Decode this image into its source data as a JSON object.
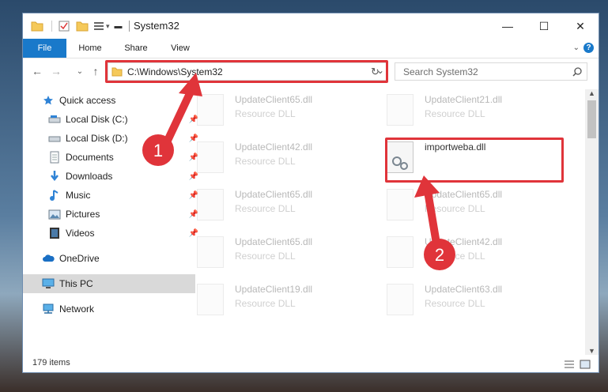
{
  "window": {
    "title": "System32",
    "minimize_glyph": "—",
    "maximize_glyph": "☐",
    "close_glyph": "✕"
  },
  "ribbon": {
    "tabs": [
      "File",
      "Home",
      "Share",
      "View"
    ],
    "help_glyph": "?"
  },
  "navigation": {
    "back_glyph": "←",
    "forward_glyph": "→",
    "recent_glyph": "⌄",
    "up_glyph": "↑",
    "address": "C:\\Windows\\System32",
    "dropdown_glyph": "⌄",
    "refresh_glyph": "↻",
    "search_placeholder": "Search System32"
  },
  "sidebar": {
    "items": [
      {
        "label": "Quick access",
        "icon": "star-icon"
      },
      {
        "label": "Local Disk (C:)",
        "icon": "drive-icon"
      },
      {
        "label": "Local Disk (D:)",
        "icon": "drive-icon"
      },
      {
        "label": "Documents",
        "icon": "documents-icon"
      },
      {
        "label": "Downloads",
        "icon": "downloads-icon"
      },
      {
        "label": "Music",
        "icon": "music-icon"
      },
      {
        "label": "Pictures",
        "icon": "pictures-icon"
      },
      {
        "label": "Videos",
        "icon": "videos-icon"
      },
      {
        "label": "OneDrive",
        "icon": "cloud-icon"
      },
      {
        "label": "This PC",
        "icon": "computer-icon"
      },
      {
        "label": "Network",
        "icon": "network-icon"
      }
    ]
  },
  "files": [
    {
      "name": "UpdateClient65.dll",
      "type": "Resource DLL"
    },
    {
      "name": "UpdateClient21.dll",
      "type": "Resource DLL"
    },
    {
      "name": "UpdateClient42.dll",
      "type": "Resource DLL"
    },
    {
      "name": "importweba.dll",
      "type": ""
    },
    {
      "name": "UpdateClient65.dll",
      "type": "Resource DLL"
    },
    {
      "name": "UpdateClient65.dll",
      "type": "Resource DLL"
    },
    {
      "name": "UpdateClient65.dll",
      "type": "Resource DLL"
    },
    {
      "name": "UpdateClient42.dll",
      "type": "Resource DLL"
    },
    {
      "name": "UpdateClient19.dll",
      "type": "Resource DLL"
    },
    {
      "name": "UpdateClient63.dll",
      "type": "Resource DLL"
    }
  ],
  "status": {
    "item_count": "179 items"
  },
  "annotations": {
    "step1": "1",
    "step2": "2",
    "color": "#e0343a"
  }
}
